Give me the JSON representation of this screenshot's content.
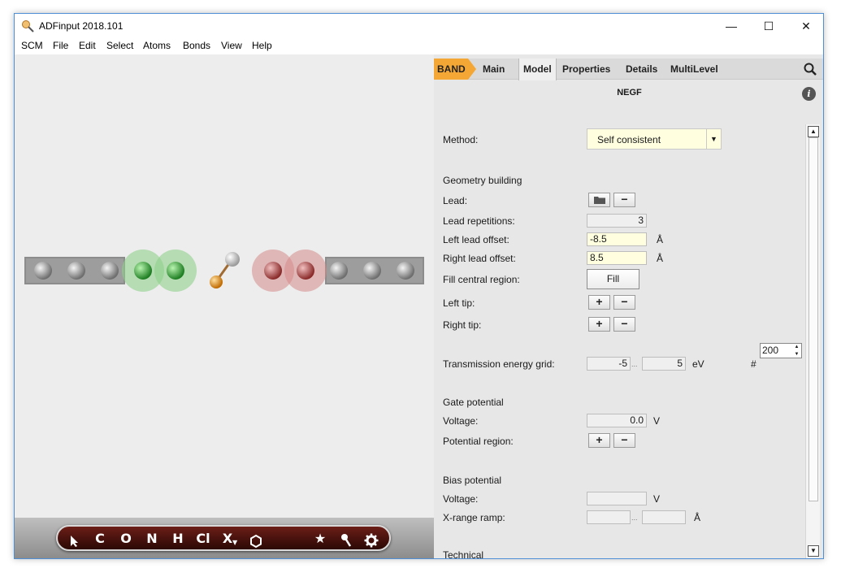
{
  "window": {
    "title": "ADFinput 2018.101",
    "minimize": "—",
    "maximize": "☐",
    "close": "✕"
  },
  "menu": [
    "SCM",
    "File",
    "Edit",
    "Select",
    "Atoms",
    "Bonds",
    "View",
    "Help"
  ],
  "toolbar": {
    "items": [
      "C",
      "O",
      "N",
      "H",
      "Cl",
      "X",
      "★"
    ]
  },
  "tabs": [
    "BAND",
    "Main",
    "Model",
    "Properties",
    "Details",
    "MultiLevel"
  ],
  "active_tab": "Model",
  "section_title": "NEGF",
  "info": "i",
  "form": {
    "method": {
      "label": "Method:",
      "value": "Self consistent"
    },
    "geometry_heading": "Geometry building",
    "lead": {
      "label": "Lead:"
    },
    "lead_repetitions": {
      "label": "Lead repetitions:",
      "value": "3"
    },
    "left_lead_offset": {
      "label": "Left lead offset:",
      "value": "-8.5",
      "unit": "Å"
    },
    "right_lead_offset": {
      "label": "Right lead offset:",
      "value": "8.5",
      "unit": "Å"
    },
    "fill_central": {
      "label": "Fill central region:",
      "button": "Fill"
    },
    "left_tip": {
      "label": "Left tip:"
    },
    "right_tip": {
      "label": "Right tip:"
    },
    "transmission": {
      "label": "Transmission energy grid:",
      "min": "-5",
      "sep": "...",
      "max": "5",
      "unit": "eV",
      "count_label": "#",
      "count": "200"
    },
    "gate_heading": "Gate potential",
    "gate_voltage": {
      "label": "Voltage:",
      "value": "0.0",
      "unit": "V"
    },
    "potential_region": {
      "label": "Potential region:"
    },
    "bias_heading": "Bias potential",
    "bias_voltage": {
      "label": "Voltage:",
      "value": "",
      "unit": "V"
    },
    "x_range_ramp": {
      "label": "X-range ramp:",
      "min": "",
      "sep": "...",
      "max": "",
      "unit": "Å"
    },
    "technical_heading": "Technical"
  },
  "buttons": {
    "plus": "+",
    "minus": "−"
  },
  "colors": {
    "band_tab": "#f5a735",
    "yellow_field": "#ffffe0",
    "lead_atom": "#8c8c8c",
    "green_atom": "#2f9e34",
    "red_atom": "#b84b4b",
    "gold_atom": "#e08a1a"
  }
}
